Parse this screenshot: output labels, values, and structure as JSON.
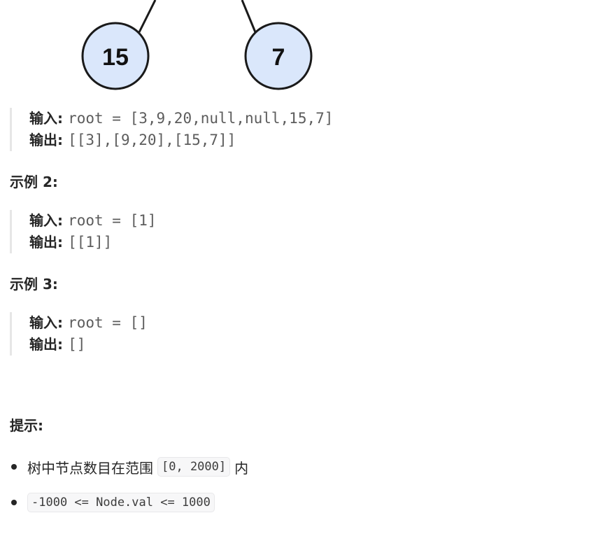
{
  "tree_nodes": [
    "15",
    "7"
  ],
  "examples": [
    {
      "input_label": "输入:",
      "input_value": "root = [3,9,20,null,null,15,7]",
      "output_label": "输出:",
      "output_value": "[[3],[9,20],[15,7]]"
    },
    {
      "heading": "示例 2:",
      "input_label": "输入:",
      "input_value": "root = [1]",
      "output_label": "输出:",
      "output_value": "[[1]]"
    },
    {
      "heading": "示例 3:",
      "input_label": "输入:",
      "input_value": "root = []",
      "output_label": "输出:",
      "output_value": "[]"
    }
  ],
  "hints": {
    "heading": "提示:",
    "item1_before": "树中节点数目在范围",
    "item1_code": "[0, 2000]",
    "item1_after": "内",
    "item2_code": "-1000 <= Node.val <= 1000"
  },
  "colors": {
    "node_fill": "#dae7fb",
    "node_stroke": "#1a1a1a"
  }
}
